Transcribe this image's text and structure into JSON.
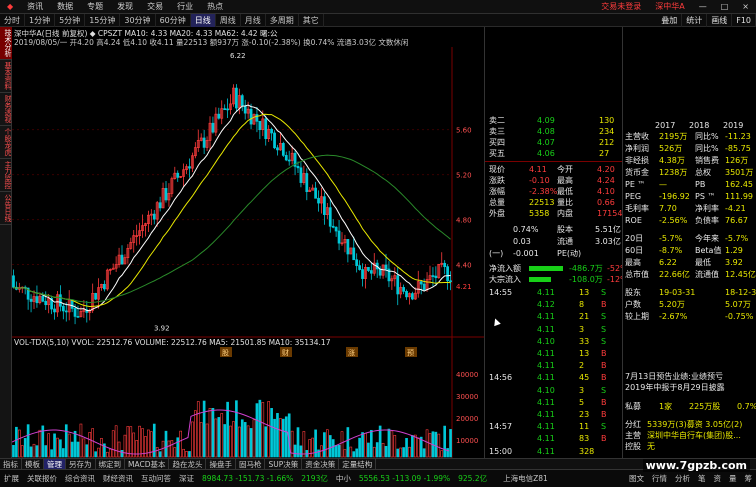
{
  "menu": {
    "items": [
      "资讯",
      "数据",
      "专题",
      "发现",
      "交易",
      "行业",
      "热点"
    ],
    "right_items": [
      "交易未登录",
      "深中华A"
    ],
    "icons": [
      "lock-icon",
      "grid-icon",
      "bell-icon"
    ]
  },
  "toolbar": {
    "periods": [
      "分时",
      "1分钟",
      "5分钟",
      "15分钟",
      "30分钟",
      "60分钟",
      "日线",
      "周线",
      "月线",
      "多周期",
      "其它"
    ],
    "active": "日线",
    "right_buttons": [
      "叠加",
      "统计",
      "画线",
      "F10"
    ]
  },
  "left_tabs": [
    "技术分析",
    "基本资料",
    "财务透视",
    "个股龙虎",
    "主力监控",
    "公告日线"
  ],
  "chart": {
    "title_line": "深中华A(日线 前复权) ◆ CPSZT  MA10: 4.33  MA20: 4.33  MA62: 4.42  曙:公",
    "info_line": "2019/08/05/一 开4.20 高4.24 低4.10 收4.11 量22513 额937万 涨-0.10(-2.38%) 换0.74% 流通3.03亿 文数休闲",
    "price_ticks": [
      "5.60",
      "5.20",
      "4.80",
      "4.40",
      "4.21"
    ],
    "high_label": "6.22",
    "low_label": "3.92",
    "event_labels": [
      "股",
      "财",
      "涨",
      "预"
    ],
    "vol_title": "VOL-TDX(5,10) VVOL: 22512.76  VOLUME: 22512.76  MA5: 21501.85  MA10: 35134.17",
    "vol_ticks": [
      "40000",
      "30000",
      "20000",
      "10000"
    ],
    "x_labels": [
      "2018年",
      "12",
      "2019年",
      "2",
      "3",
      "4",
      "5",
      "6",
      "7",
      "8"
    ],
    "chart_controls": [
      "日线"
    ]
  },
  "quote": {
    "asks": [
      {
        "label": "卖二",
        "price": "4.09",
        "vol": "130"
      },
      {
        "label": "卖三",
        "price": "4.08",
        "vol": "234"
      },
      {
        "label": "买四",
        "price": "4.07",
        "vol": "212"
      },
      {
        "label": "买五",
        "price": "4.06",
        "vol": "27"
      }
    ],
    "stats": [
      {
        "l1": "现价",
        "v1": "4.11",
        "l2": "今开",
        "v2": "4.20"
      },
      {
        "l1": "涨跌",
        "v1": "-0.10",
        "l2": "最高",
        "v2": "4.24"
      },
      {
        "l1": "涨幅",
        "v1": "-2.38%",
        "l2": "最低",
        "v2": "4.10"
      },
      {
        "l1": "总量",
        "v1": "22513",
        "l2": "量比",
        "v2": "0.66"
      },
      {
        "l1": "外盘",
        "v1": "5358",
        "l2": "内盘",
        "v2": "17154"
      }
    ],
    "stats2": [
      {
        "v1": "0.74%",
        "l2": "股本",
        "v2": "5.51亿"
      },
      {
        "v1": "0.03",
        "l2": "流通",
        "v2": "3.03亿"
      },
      {
        "l1": "(一)",
        "v1": "-0.001",
        "l2": "PE(动)",
        "v2": ""
      }
    ],
    "flows": [
      {
        "label": "净流入额",
        "value": "-486.7万",
        "pct": "-52%"
      },
      {
        "label": "大宗流入",
        "value": "-108.0万",
        "pct": "-12%"
      }
    ],
    "ticks": [
      {
        "time": "14:55",
        "price": "4.11",
        "vol": "13",
        "dir": "S"
      },
      {
        "time": "",
        "price": "4.12",
        "vol": "8",
        "dir": "B"
      },
      {
        "time": "",
        "price": "4.11",
        "vol": "21",
        "dir": "S"
      },
      {
        "time": "",
        "price": "4.11",
        "vol": "3",
        "dir": "S"
      },
      {
        "time": "",
        "price": "4.10",
        "vol": "33",
        "dir": "S"
      },
      {
        "time": "",
        "price": "4.11",
        "vol": "13",
        "dir": "B"
      },
      {
        "time": "",
        "price": "4.11",
        "vol": "2",
        "dir": "B"
      },
      {
        "time": "14:56",
        "price": "4.11",
        "vol": "45",
        "dir": "B"
      },
      {
        "time": "",
        "price": "4.10",
        "vol": "3",
        "dir": "S"
      },
      {
        "time": "",
        "price": "4.11",
        "vol": "5",
        "dir": "B"
      },
      {
        "time": "",
        "price": "4.11",
        "vol": "23",
        "dir": "B"
      },
      {
        "time": "14:57",
        "price": "4.11",
        "vol": "11",
        "dir": "S"
      },
      {
        "time": "",
        "price": "4.11",
        "vol": "83",
        "dir": "B"
      },
      {
        "time": "15:00",
        "price": "4.11",
        "vol": "328",
        "dir": ""
      }
    ]
  },
  "finance": {
    "years": [
      "2017",
      "2018",
      "2019"
    ],
    "rows": [
      {
        "l": "主营收",
        "v1": "2195万",
        "l2": "同比%",
        "v2": "-11.23"
      },
      {
        "l": "净利润",
        "v1": "526万",
        "l2": "同比%",
        "v2": "-85.75"
      },
      {
        "l": "非经损",
        "v1": "4.38万",
        "l2": "销售费",
        "v2": "126万"
      },
      {
        "l": "货币金",
        "v1": "1238万",
        "l2": "总权",
        "v2": "3501万"
      },
      {
        "l": "PE ™",
        "v1": "—",
        "l2": "PB",
        "v2": "162.45"
      },
      {
        "l": "PEG",
        "v1": "-196.92",
        "l2": "PS ™",
        "v2": "111.99"
      },
      {
        "l": "毛利率",
        "v1": "7.70",
        "l2": "净利率",
        "v2": "-4.21"
      },
      {
        "l": "ROE",
        "v1": "-2.56%",
        "l2": "负债率",
        "v2": "76.67"
      },
      {
        "l": "20日",
        "v1": "-5.7%",
        "l2": "今年来",
        "v2": "-5.7%"
      },
      {
        "l": "60日",
        "v1": "-8.7%",
        "l2": "Beta值",
        "v2": "1.29"
      },
      {
        "l": "最高",
        "v1": "6.22",
        "l2": "最低",
        "v2": "3.92"
      },
      {
        "l": "总市值",
        "v1": "22.66亿",
        "l2": "流通值",
        "v2": "12.45亿"
      },
      {
        "l": "股东",
        "v1": "19-03-31",
        "l2": "",
        "v2": "18-12-31"
      },
      {
        "l": "户数",
        "v1": "5.20万",
        "l2": "",
        "v2": "5.07万"
      },
      {
        "l": "较上期",
        "v1": "-2.67%",
        "l2": "",
        "v2": "-0.75%"
      }
    ],
    "news": [
      "7月13日预告业绩:业绩预亏",
      "2019年中报于8月29日披露"
    ],
    "holders": {
      "label": "私募",
      "v1": "1家",
      "v2": "225万股",
      "v3": "0.7%"
    },
    "extra": [
      {
        "l": "分红",
        "v": "5339万(3)募资  3.05亿(2)"
      },
      {
        "l": "主营",
        "v": "深圳中华自行车(集团)股..."
      },
      {
        "l": "控股",
        "v": "无"
      }
    ]
  },
  "bottom_tabs": [
    "指标",
    "模板",
    "管理",
    "另存为",
    "绑定到",
    "MACD基本",
    "趋在龙头",
    "操盘手",
    "固马枪",
    "SUP决策",
    "资金决策",
    "定量结构"
  ],
  "bottom_tabs_sel": "管理",
  "bottom_tabs2": [
    "扩展",
    "关联报价",
    "综合资讯",
    "财经资讯",
    "互动问答"
  ],
  "status": {
    "segments": [
      {
        "label": "深证",
        "value": "8984.73 -151.73 -1.66%",
        "extra": "2193亿",
        "color": "#18d018"
      },
      {
        "label": "中小",
        "value": "5556.53 -113.09 -1.99%",
        "extra": "925.2亿",
        "color": "#18d018"
      },
      {
        "label": "",
        "value": "上海电信Z81",
        "extra": "",
        "color": "#c8c8c8"
      }
    ],
    "right": [
      "图文",
      "行情",
      "分析",
      "笔",
      "资",
      "量",
      "筹"
    ]
  },
  "watermark": "www.7gpzb.com",
  "colors": {
    "up": "#ff3c3c",
    "down": "#18d018",
    "ma10": "#ffffff",
    "ma20": "#e8e800",
    "ma62": "#d040d0"
  }
}
